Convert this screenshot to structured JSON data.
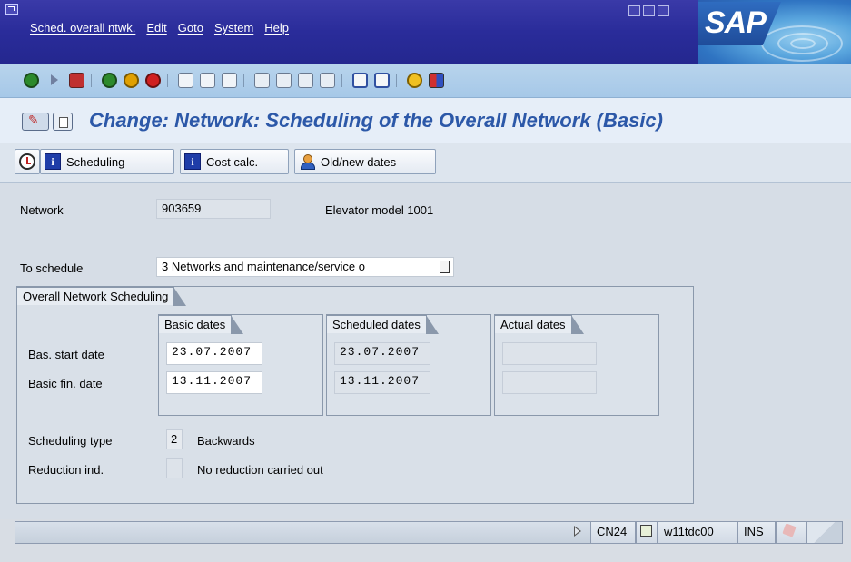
{
  "menu": {
    "items": [
      "Sched. overall ntwk.",
      "Edit",
      "Goto",
      "System",
      "Help"
    ]
  },
  "logo": {
    "text": "SAP"
  },
  "title": {
    "text": "Change: Network: Scheduling of the Overall Network (Basic)"
  },
  "app_toolbar": {
    "scheduling_label": "Scheduling",
    "cost_calc_label": "Cost calc.",
    "old_new_dates_label": "Old/new dates"
  },
  "header_fields": {
    "network_label": "Network",
    "network_value": "903659",
    "network_desc": "Elevator model 1001",
    "to_schedule_label": "To schedule",
    "to_schedule_value": "3 Networks and  maintenance/service o"
  },
  "group": {
    "title": "Overall Network Scheduling",
    "basic_dates_header": "Basic dates",
    "scheduled_dates_header": "Scheduled dates",
    "actual_dates_header": "Actual dates",
    "start_label": "Bas. start date",
    "finish_label": "Basic fin. date",
    "basic_start": "23.07.2007",
    "basic_finish": "13.11.2007",
    "scheduled_start": "23.07.2007",
    "scheduled_finish": "13.11.2007",
    "actual_start": "",
    "actual_finish": "",
    "scheduling_type_label": "Scheduling type",
    "scheduling_type_value": "2",
    "scheduling_type_desc": "Backwards",
    "reduction_label": "Reduction ind.",
    "reduction_value": "",
    "reduction_desc": "No reduction carried out"
  },
  "statusbar": {
    "transaction": "CN24",
    "server": "w11tdc00",
    "mode": "INS"
  },
  "colors": {
    "menubar": "#2a2c9a",
    "title_text": "#2c58a8",
    "toolbar": "#a6c8e8"
  },
  "icons": {
    "standard_toolbar": [
      "enter-icon",
      "save-icon",
      "back-icon",
      "exit-icon",
      "cancel-icon",
      "print-icon",
      "find-icon",
      "find-next-icon",
      "first-page-icon",
      "previous-page-icon",
      "next-page-icon",
      "last-page-icon",
      "create-session-icon",
      "shortcut-icon",
      "help-icon",
      "layout-icon"
    ]
  }
}
